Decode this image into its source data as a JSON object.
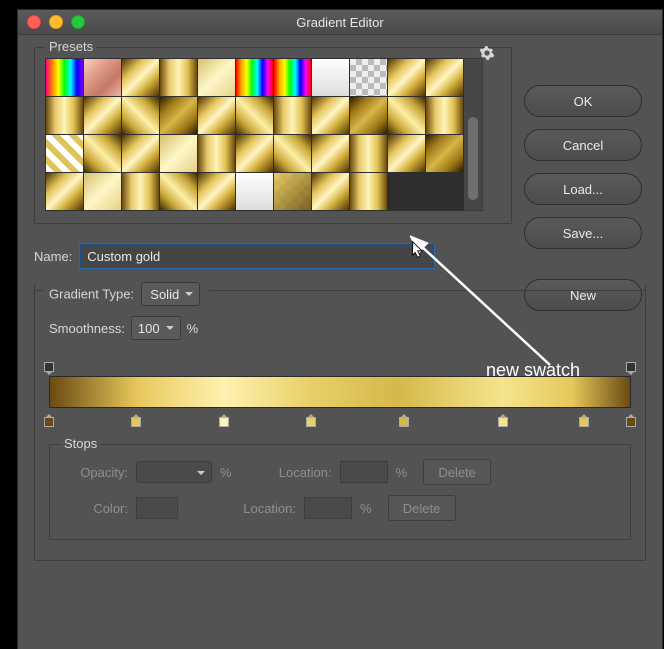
{
  "window": {
    "title": "Gradient Editor"
  },
  "presets": {
    "label": "Presets",
    "swatches": [
      "g-rainbow",
      "g-rose",
      "g-gold",
      "g-gold2",
      "g-gold-lt",
      "g-rainbow2",
      "g-rainbow2",
      "g-white",
      "g-checker",
      "g-gold",
      "g-gold",
      "g-gold2",
      "g-gold",
      "g-gold3",
      "g-gold-dk",
      "g-gold",
      "g-gold3",
      "g-gold2",
      "g-gold",
      "g-gold-dk",
      "g-gold3",
      "g-gold2",
      "g-stripes",
      "g-gold3",
      "g-gold",
      "g-gold-lt",
      "g-gold2",
      "g-gold",
      "g-gold3",
      "g-gold",
      "g-gold2",
      "g-gold",
      "g-gold-dk",
      "g-gold",
      "g-gold-lt",
      "g-gold2",
      "g-gold3",
      "g-gold",
      "g-white",
      "g-gold-checker",
      "g-gold",
      "g-gold2"
    ]
  },
  "buttons": {
    "ok": "OK",
    "cancel": "Cancel",
    "load": "Load...",
    "save": "Save...",
    "new": "New"
  },
  "name": {
    "label": "Name:",
    "value": "Custom gold"
  },
  "gradientType": {
    "label": "Gradient Type:",
    "value": "Solid"
  },
  "smoothness": {
    "label": "Smoothness:",
    "value": "100",
    "unit": "%"
  },
  "colorStops": {
    "positions_pct": [
      0,
      15,
      30,
      45,
      61,
      78,
      92,
      100
    ],
    "colors": [
      "#6b4a12",
      "#e7c75a",
      "#fff2b0",
      "#e8cf68",
      "#d6b84a",
      "#f5e48e",
      "#e6c85a",
      "#6b4a12"
    ]
  },
  "opacityStops": {
    "positions_pct": [
      0,
      100
    ]
  },
  "stops": {
    "label": "Stops",
    "opacity": "Opacity:",
    "color": "Color:",
    "location": "Location:",
    "unit": "%",
    "delete": "Delete"
  },
  "annotation": {
    "text": "new swatch"
  }
}
